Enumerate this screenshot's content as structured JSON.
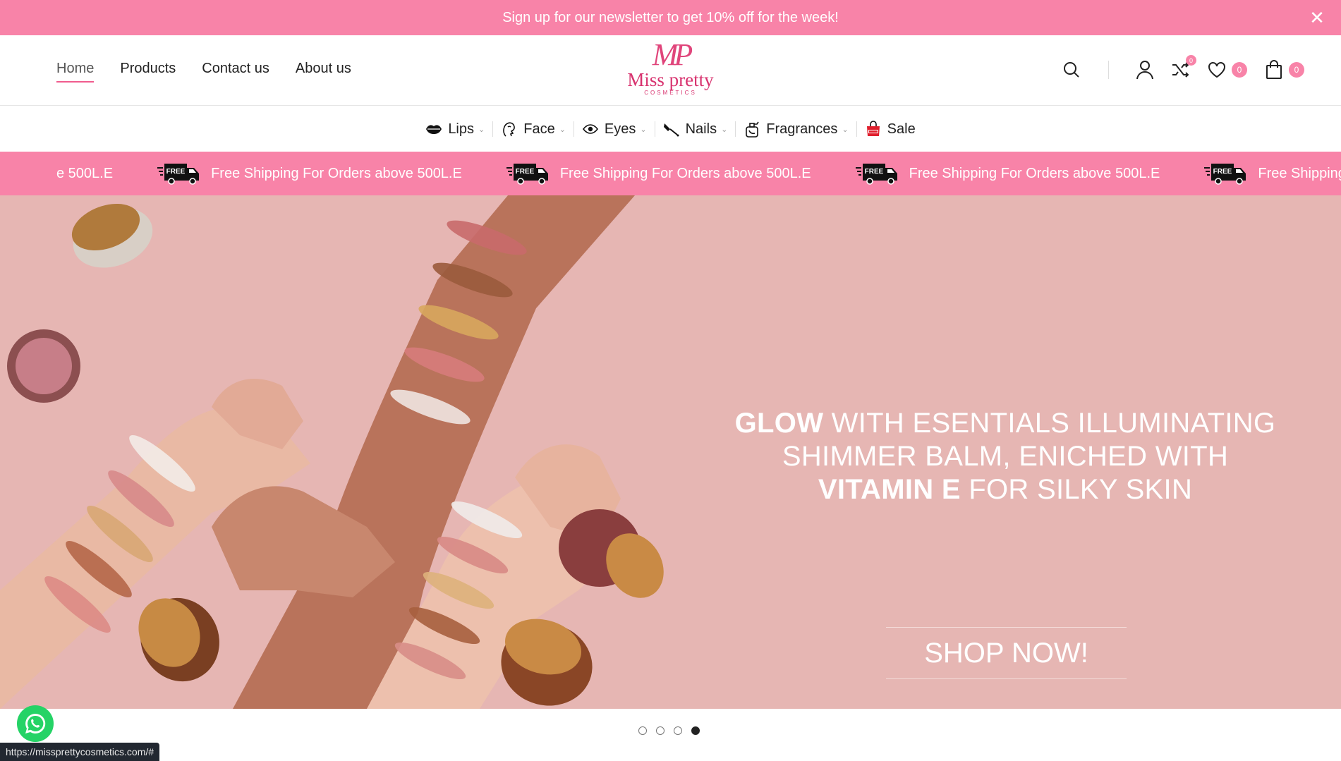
{
  "announcement": {
    "text": "Sign up for our newsletter to get 10% off for the week!"
  },
  "main_nav": [
    {
      "label": "Home",
      "active": true
    },
    {
      "label": "Products",
      "active": false
    },
    {
      "label": "Contact us",
      "active": false
    },
    {
      "label": "About us",
      "active": false
    }
  ],
  "logo": {
    "mark": "MP",
    "name": "Miss pretty",
    "sub": "COSMETICS"
  },
  "header_icons": {
    "compare_count": "0",
    "wishlist_count": "0",
    "cart_count": "0"
  },
  "categories": [
    {
      "label": "Lips",
      "icon": "lips-icon",
      "has_dropdown": true
    },
    {
      "label": "Face",
      "icon": "face-icon",
      "has_dropdown": true
    },
    {
      "label": "Eyes",
      "icon": "eye-icon",
      "has_dropdown": true
    },
    {
      "label": "Nails",
      "icon": "nail-polish-icon",
      "has_dropdown": true
    },
    {
      "label": "Fragrances",
      "icon": "perfume-icon",
      "has_dropdown": true
    },
    {
      "label": "Sale",
      "icon": "sale-bag-icon",
      "has_dropdown": false
    }
  ],
  "marquee": {
    "partial_text": "e 500L.E",
    "item_text": "Free Shipping For Orders above 500L.E",
    "truck_label": "FREE",
    "trailing_text": "Free Shipping"
  },
  "hero": {
    "headline_bold_1": "GLOW",
    "headline_rest_1": " WITH ESENTIALS ILLUMINATING",
    "headline_line_2": "SHIMMER BALM,  ENICHED WITH",
    "headline_bold_3": "VITAMIN E",
    "headline_rest_3": "  FOR SILKY SKIN",
    "cta": "SHOP NOW!"
  },
  "slider": {
    "count": 4,
    "active_index": 3
  },
  "status_bar": {
    "url": "https://missprettycosmetics.com/#"
  },
  "colors": {
    "brand_pink": "#f883a8",
    "hero_bg": "#e6b6b3",
    "logo": "#d8336f"
  }
}
